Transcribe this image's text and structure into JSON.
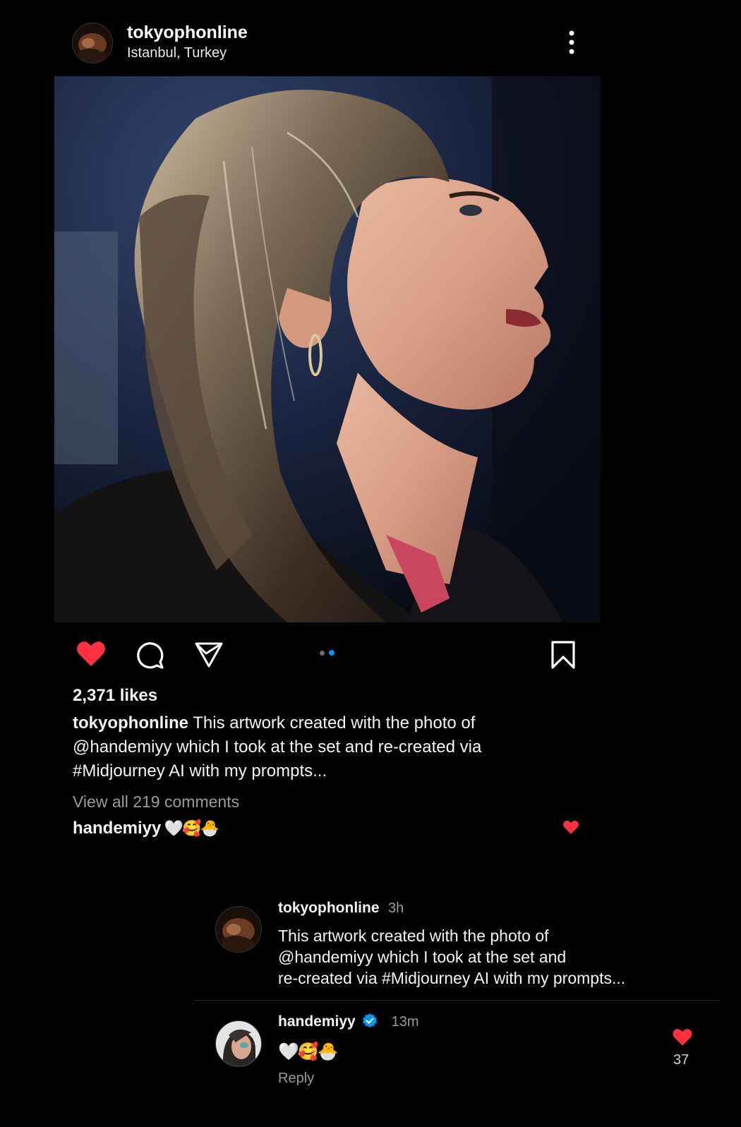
{
  "post": {
    "username": "tokyophonline",
    "location": "Istanbul, Turkey",
    "likes": "2,371 likes",
    "caption_user": "tokyophonline",
    "caption_line1": "This artwork created with the photo of",
    "caption_line2": "@handemiyy which I took at the set and re-created via",
    "caption_line3": "#Midjourney AI with my prompts...",
    "view_all_comments": "View all 219 comments",
    "top_comment_user": "handemiyy",
    "top_comment_text": "🤍🥰🐣",
    "carousel_index": 2,
    "carousel_count": 2,
    "liked": true
  },
  "thread": [
    {
      "username": "tokyophonline",
      "time": "3h",
      "text_line1": "This artwork created with the photo of",
      "text_line2": "@handemiyy which I took at the set and",
      "text_line3": "re-created via #Midjourney AI with my prompts..."
    },
    {
      "username": "handemiyy",
      "verified": true,
      "time": "13m",
      "text": "🤍🥰🐣",
      "reply_label": "Reply",
      "like_count": "37"
    }
  ],
  "colors": {
    "background": "#000000",
    "like_red": "#ff3040",
    "carousel_active": "#0095f6",
    "verified_blue": "#0095f6",
    "muted_text": "#9a9a9a"
  },
  "icons": {
    "more": "more-vertical-icon",
    "like": "heart-filled-icon",
    "comment": "comment-bubble-icon",
    "share": "paper-plane-icon",
    "save": "bookmark-icon",
    "verified": "verified-badge-icon"
  }
}
